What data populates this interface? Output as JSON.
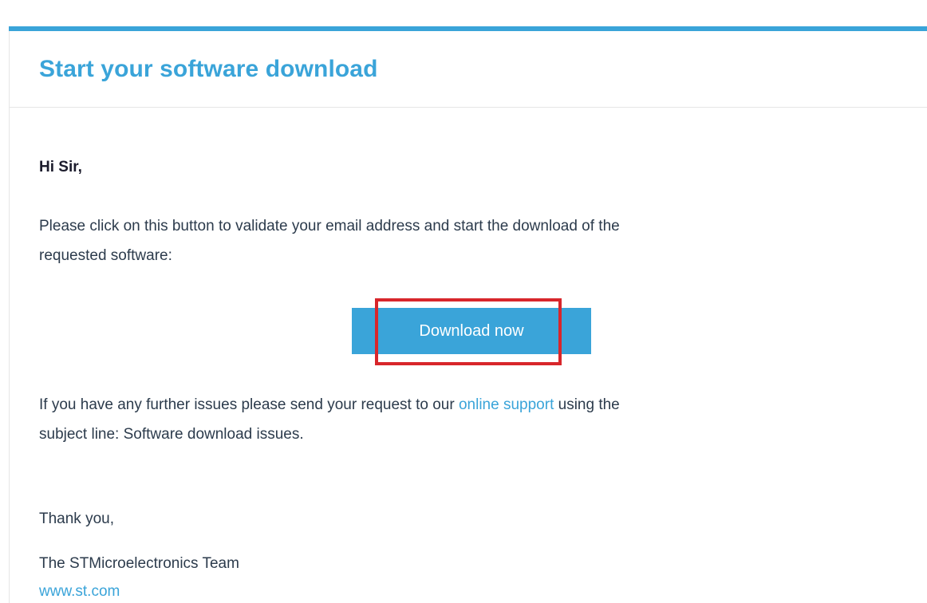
{
  "email": {
    "title": "Start your software download",
    "greeting": "Hi Sir,",
    "intro_line1": "Please click on this button to validate your email address and start the download of the",
    "intro_line2": "requested software:",
    "download_button_label": "Download now",
    "support_text_before": "If you have any further issues please send your request to our",
    "support_link_text": "online support",
    "support_text_after": "using the",
    "support_line2": "subject line: Software download issues.",
    "thanks": "Thank you,",
    "signature": "The STMicroelectronics Team",
    "website_link": "www.st.com"
  },
  "colors": {
    "accent": "#3aa4d9",
    "highlight": "#d8262b",
    "body_text": "#2c3b4c"
  }
}
